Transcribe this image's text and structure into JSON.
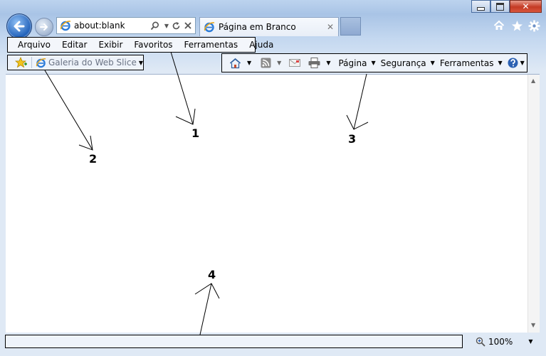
{
  "browser": {
    "address": "about:blank",
    "tab_title": "Página em Branco"
  },
  "menu": {
    "items": [
      "Arquivo",
      "Editar",
      "Exibir",
      "Favoritos",
      "Ferramentas",
      "Ajuda"
    ]
  },
  "favorites_bar": {
    "web_slice_label": "Galeria do Web Slice"
  },
  "command_bar": {
    "page_label": "Página",
    "security_label": "Segurança",
    "tools_label": "Ferramentas"
  },
  "status_bar": {
    "zoom": "100%"
  },
  "annotations": {
    "n1": "1",
    "n2": "2",
    "n3": "3",
    "n4": "4"
  },
  "icons": {
    "back": "back-arrow-icon",
    "forward": "forward-arrow-icon",
    "ie": "ie-logo-icon",
    "search": "search-icon",
    "refresh": "refresh-icon",
    "stop": "close-icon",
    "home": "home-icon",
    "favorites": "star-icon",
    "settings": "gear-icon",
    "feeds": "rss-icon",
    "mail": "mail-icon",
    "print": "printer-icon",
    "help": "help-icon"
  }
}
